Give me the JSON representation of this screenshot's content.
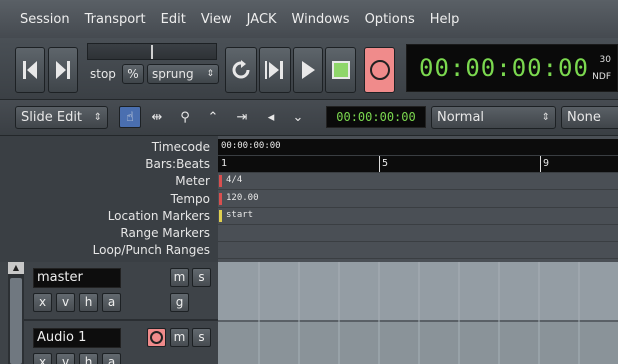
{
  "menu": [
    "Session",
    "Transport",
    "Edit",
    "View",
    "JACK",
    "Windows",
    "Options",
    "Help"
  ],
  "transport": {
    "stop_label": "stop",
    "percent_label": "%",
    "sprung_label": "sprung",
    "clock_time": "00:00:00:00",
    "clock_fps": "30",
    "clock_mode": "NDF",
    "record_color": "#f08b8b",
    "stop_color": "#8fd66a"
  },
  "edit_toolbar": {
    "edit_mode": "Slide Edit",
    "mini_clock": "00:00:00:00",
    "snap_mode": "Normal",
    "grid": "None"
  },
  "rulers": {
    "labels": [
      "Timecode",
      "Bars:Beats",
      "Meter",
      "Tempo",
      "Location Markers",
      "Range Markers",
      "Loop/Punch Ranges"
    ],
    "timecode_start": "00:00:00:00",
    "bar_numbers": [
      "1",
      "5",
      "9"
    ],
    "meter_value": "4/4",
    "tempo_value": "120.00",
    "location_marker": "start"
  },
  "tracks": [
    {
      "name": "master",
      "buttons": [
        "m",
        "s",
        "g"
      ],
      "small": [
        "x",
        "v",
        "h",
        "a"
      ]
    },
    {
      "name": "Audio 1",
      "buttons": [
        "m",
        "s"
      ],
      "small": [
        "x",
        "v",
        "h",
        "a"
      ]
    }
  ]
}
